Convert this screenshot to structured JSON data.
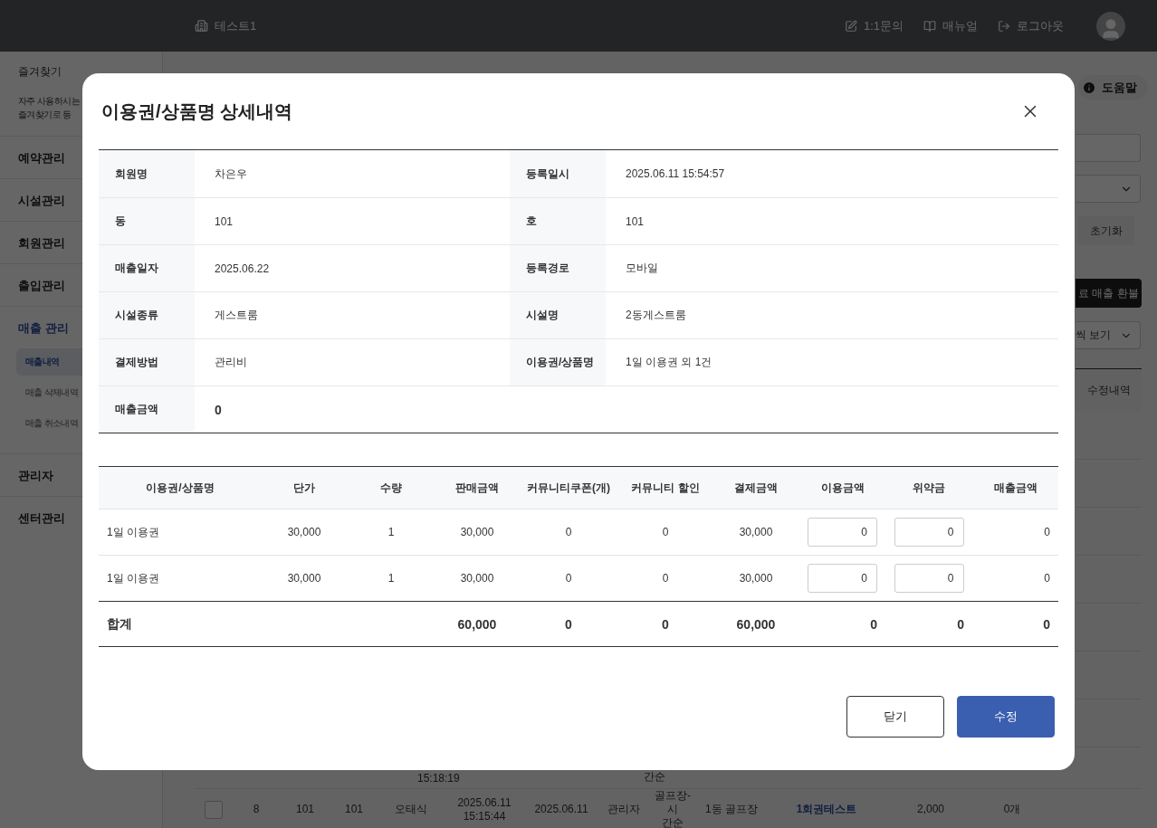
{
  "header": {
    "site": "테스트1",
    "links": [
      {
        "kind": "inquiry",
        "label": "1:1문의"
      },
      {
        "kind": "manual",
        "label": "매뉴얼"
      },
      {
        "kind": "logout",
        "label": "로그아웃"
      }
    ]
  },
  "sidebar": {
    "favorites": {
      "title": "즐겨찾기",
      "lines": [
        "자주 사용하시는",
        "즐겨찾기로 등"
      ]
    },
    "items": [
      {
        "label": "예약관리",
        "selected": false
      },
      {
        "label": "시설관리",
        "selected": false
      },
      {
        "label": "회원관리",
        "selected": false
      },
      {
        "label": "출입관리",
        "selected": false
      },
      {
        "label": "매출 관리",
        "selected": true,
        "children": [
          {
            "label": "매출내역",
            "selected": true
          },
          {
            "label": "매출 삭제내역",
            "selected": false
          },
          {
            "label": "매출 취소내역",
            "selected": false
          }
        ]
      },
      {
        "label": "관리자",
        "selected": false
      },
      {
        "label": "센터관리",
        "selected": false
      }
    ]
  },
  "background": {
    "help": "도움말",
    "reset": "초기화",
    "refund": "료 매출 환불",
    "view_select": "씩 보기",
    "column_header": "수정내역",
    "partial_row": [
      "15:18:19",
      "간순"
    ],
    "row": {
      "checked": false,
      "no": "8",
      "dong": "101",
      "ho": "101",
      "member": "오태식",
      "registered": [
        "2025.06.11",
        "15:15:44"
      ],
      "sales_date": "2025.06.11",
      "route": "관리자",
      "facility_type": [
        "골프장-시",
        "간순"
      ],
      "facility": "1동 골프장",
      "product": "1회권테스트",
      "amount": "2,000",
      "count": "0개"
    }
  },
  "modal": {
    "title": "이용권/상품명 상세내역",
    "info": [
      [
        {
          "label": "회원명",
          "value": "차은우"
        },
        {
          "label": "등록일시",
          "value": "2025.06.11 15:54:57"
        }
      ],
      [
        {
          "label": "동",
          "value": "101"
        },
        {
          "label": "호",
          "value": "101"
        }
      ],
      [
        {
          "label": "매출일자",
          "value": "2025.06.22"
        },
        {
          "label": "등록경로",
          "value": "모바일"
        }
      ],
      [
        {
          "label": "시설종류",
          "value": "게스트룸"
        },
        {
          "label": "시설명",
          "value": "2동게스트룸"
        }
      ],
      [
        {
          "label": "결제방법",
          "value": "관리비"
        },
        {
          "label": "이용권/상품명",
          "value": "1일 이용권 외 1건"
        }
      ],
      [
        {
          "label": "매출금액",
          "value": "0"
        }
      ]
    ],
    "columns": [
      "이용권/상품명",
      "단가",
      "수량",
      "판매금액",
      "커뮤니티쿠폰(개)",
      "커뮤니티 할인",
      "결제금액",
      "이용금액",
      "위약금",
      "매출금액"
    ],
    "rows": [
      {
        "cells": [
          "1일 이용권",
          "30,000",
          "1",
          "30,000",
          "0",
          "0",
          "30,000",
          "0",
          "0",
          "0"
        ]
      },
      {
        "cells": [
          "1일 이용권",
          "30,000",
          "1",
          "30,000",
          "0",
          "0",
          "30,000",
          "0",
          "0",
          "0"
        ]
      }
    ],
    "total": {
      "label": "합계",
      "values": [
        "60,000",
        "0",
        "0",
        "60,000",
        "0",
        "0",
        "0"
      ]
    },
    "buttons": [
      {
        "kind": "secondary",
        "label": "닫기"
      },
      {
        "kind": "primary",
        "label": "수정"
      }
    ]
  }
}
